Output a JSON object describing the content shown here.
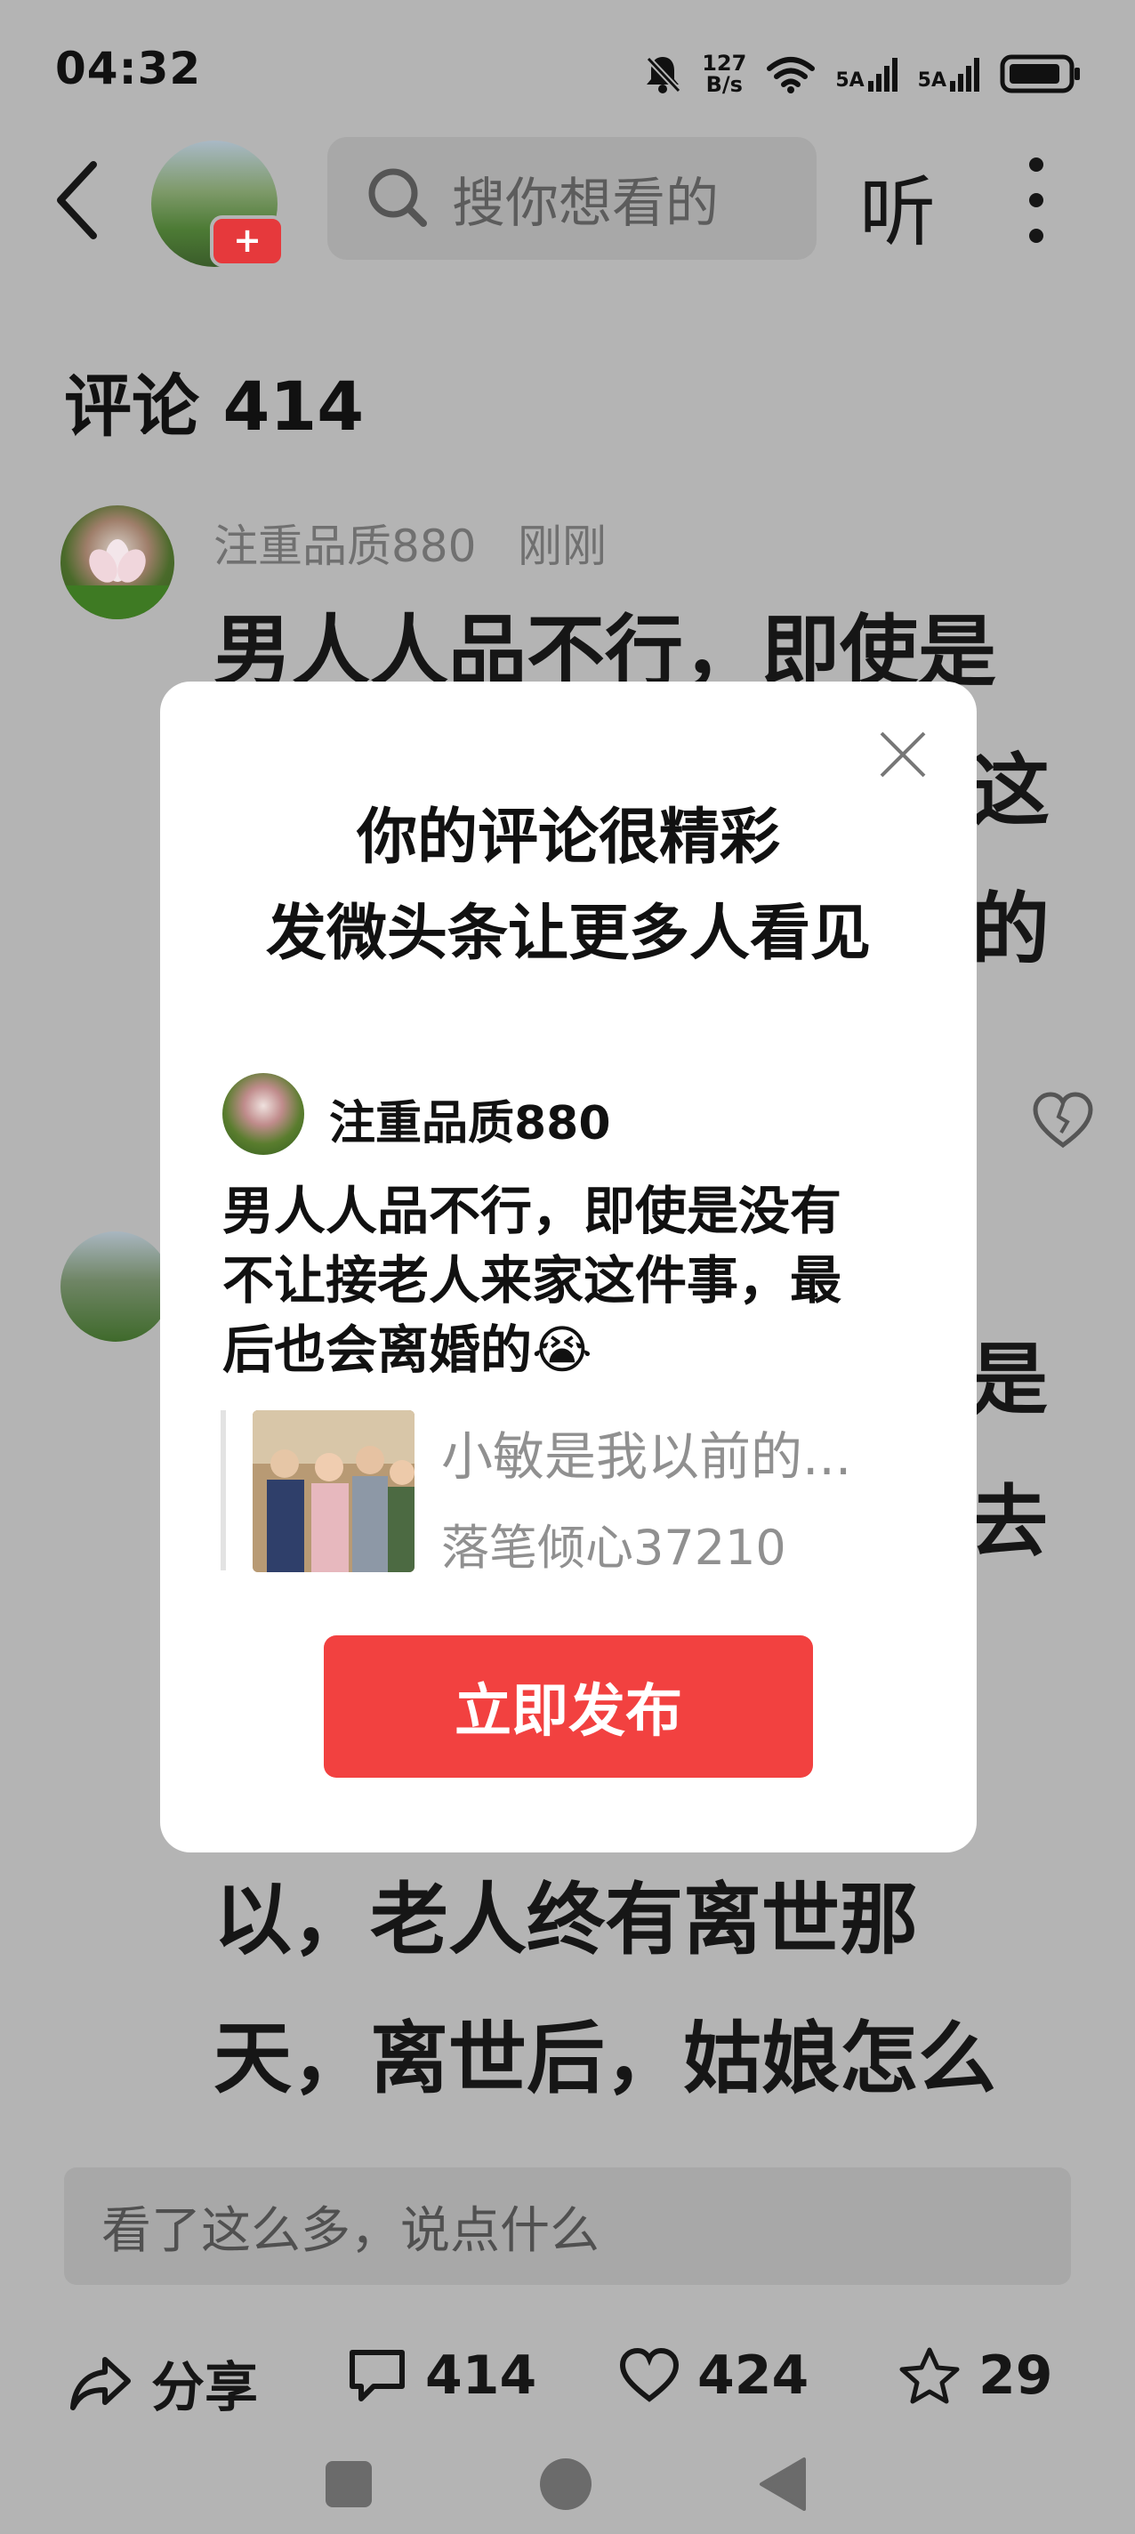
{
  "status_bar": {
    "time": "04:32",
    "net_speed_value": "127",
    "net_speed_unit": "B/s",
    "sim1_label": "5A",
    "sim2_label": "5A"
  },
  "header": {
    "search_placeholder": "搜你想看的",
    "listen_label": "听",
    "avatar_badge": "+"
  },
  "comments": {
    "title": "评论 414",
    "items": [
      {
        "author": "注重品质880",
        "time": "刚刚",
        "text_lines": [
          "男人人品不行，即使是",
          "这",
          "的"
        ]
      },
      {
        "text_lines": [
          "是",
          "去",
          "以，老人终有离世那",
          "天，离世后，姑娘怎么"
        ]
      }
    ]
  },
  "modal": {
    "title_line1": "你的评论很精彩",
    "title_line2": "发微头条让更多人看见",
    "preview": {
      "author": "注重品质880",
      "text_line1": "男人人品不行，即使是没有",
      "text_line2": "不让接老人来家这件事，最",
      "text_line3": "后也会离婚的😭",
      "ref_title": "小敏是我以前的...",
      "ref_author": "落笔倾心37210"
    },
    "publish_label": "立即发布"
  },
  "bottom_bar": {
    "input_placeholder": "看了这么多，说点什么",
    "share_label": "分享",
    "comment_count": "414",
    "like_count": "424",
    "fav_count": "29"
  },
  "colors": {
    "overlay_bg": "#b4b4b4",
    "accent_red": "#f24140",
    "modal_bg": "#ffffff"
  }
}
